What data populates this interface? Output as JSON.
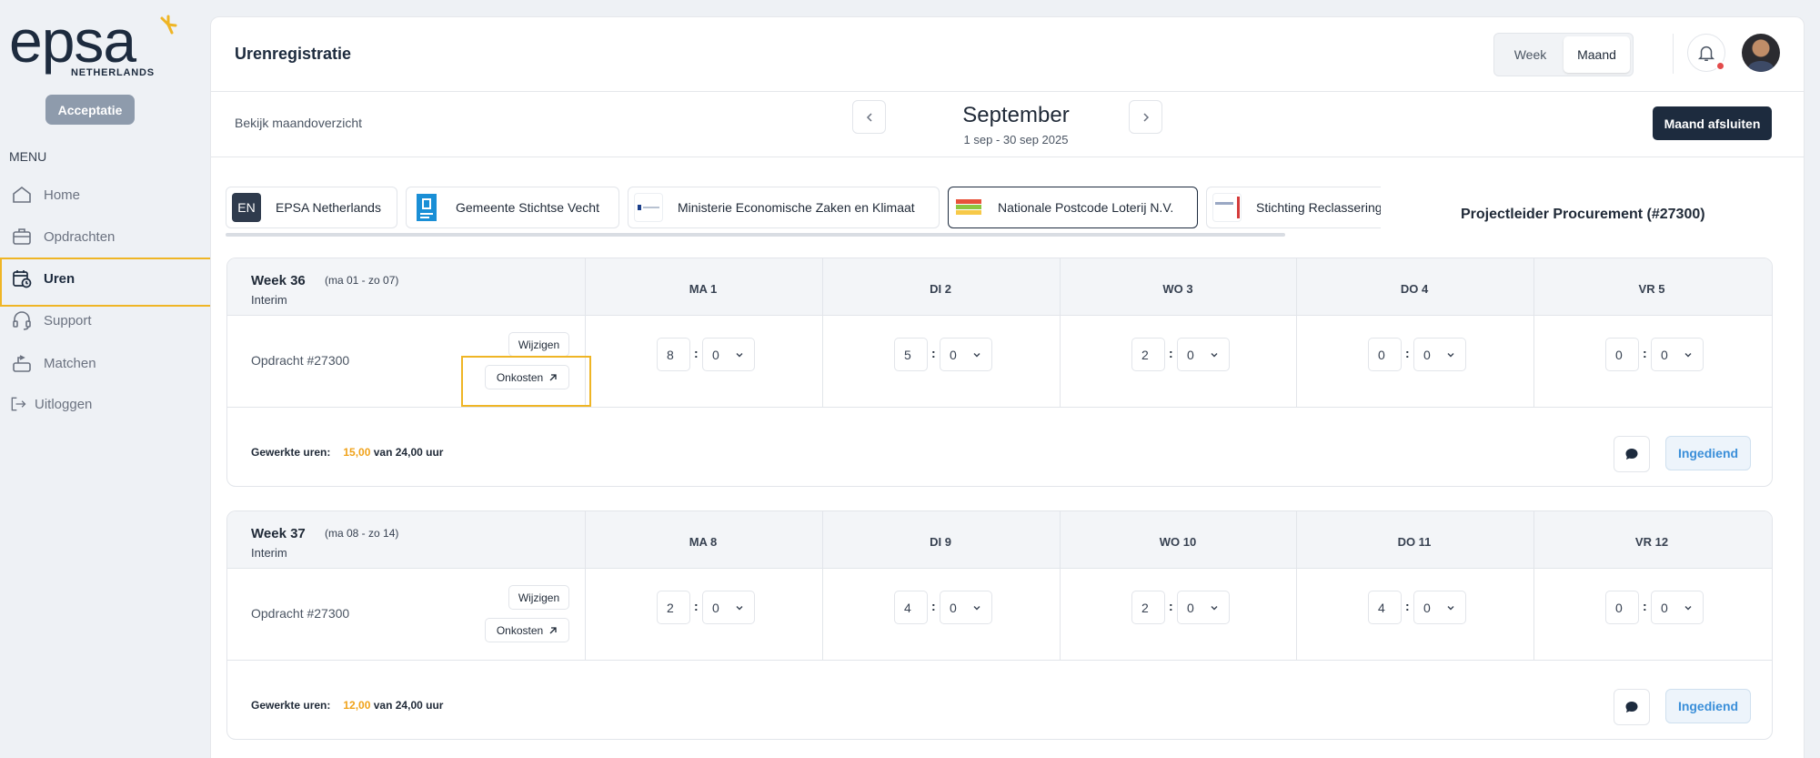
{
  "brand": {
    "logo_text": "epsa",
    "logo_sub": "NETHERLANDS",
    "accent": "#efb525",
    "navy": "#1d2b3e"
  },
  "sidebar": {
    "environment_badge": "Acceptatie",
    "menu_label": "MENU",
    "items": [
      {
        "label": "Home",
        "icon": "home-icon"
      },
      {
        "label": "Opdrachten",
        "icon": "briefcase-icon"
      },
      {
        "label": "Uren",
        "icon": "calendar-clock-icon",
        "active": true
      },
      {
        "label": "Support",
        "icon": "headset-icon"
      },
      {
        "label": "Matchen",
        "icon": "match-icon"
      },
      {
        "label": "Uitloggen",
        "icon": "logout-icon"
      }
    ]
  },
  "header": {
    "title": "Urenregistratie",
    "view_toggle": {
      "week": "Week",
      "month": "Maand",
      "selected": "Maand"
    }
  },
  "subbar": {
    "overview_link": "Bekijk maandoverzicht",
    "month": "September",
    "range": "1 sep - 30 sep 2025",
    "close_button": "Maand afsluiten"
  },
  "clients": [
    {
      "label": "EPSA Netherlands",
      "logo_text": "EN"
    },
    {
      "label": "Gemeente Stichtse Vecht"
    },
    {
      "label": "Ministerie Economische Zaken en Klimaat"
    },
    {
      "label": "Nationale Postcode Loterij N.V.",
      "selected": true
    },
    {
      "label": "Stichting Reclassering Nederland"
    }
  ],
  "project_title": "Projectleider Procurement (#27300)",
  "weeks": [
    {
      "title": "Week 36",
      "dates": "(ma 01 - zo 07)",
      "type": "Interim",
      "days": [
        "MA 1",
        "DI 2",
        "WO 3",
        "DO 4",
        "VR 5"
      ],
      "assignment": "Opdracht #27300",
      "edit_label": "Wijzigen",
      "expenses_label": "Onkosten",
      "hours": [
        "8",
        "5",
        "2",
        "0",
        "0"
      ],
      "minutes": [
        "0",
        "0",
        "0",
        "0",
        "0"
      ],
      "worked_label": "Gewerkte uren:",
      "worked_amount": "15,00",
      "worked_total": "van 24,00 uur",
      "status": "Ingediend"
    },
    {
      "title": "Week 37",
      "dates": "(ma 08 - zo 14)",
      "type": "Interim",
      "days": [
        "MA 8",
        "DI 9",
        "WO 10",
        "DO 11",
        "VR 12"
      ],
      "assignment": "Opdracht #27300",
      "edit_label": "Wijzigen",
      "expenses_label": "Onkosten",
      "hours": [
        "2",
        "4",
        "2",
        "4",
        "0"
      ],
      "minutes": [
        "0",
        "0",
        "0",
        "0",
        "0"
      ],
      "worked_label": "Gewerkte uren:",
      "worked_amount": "12,00",
      "worked_total": "van 24,00 uur",
      "status": "Ingediend"
    }
  ]
}
